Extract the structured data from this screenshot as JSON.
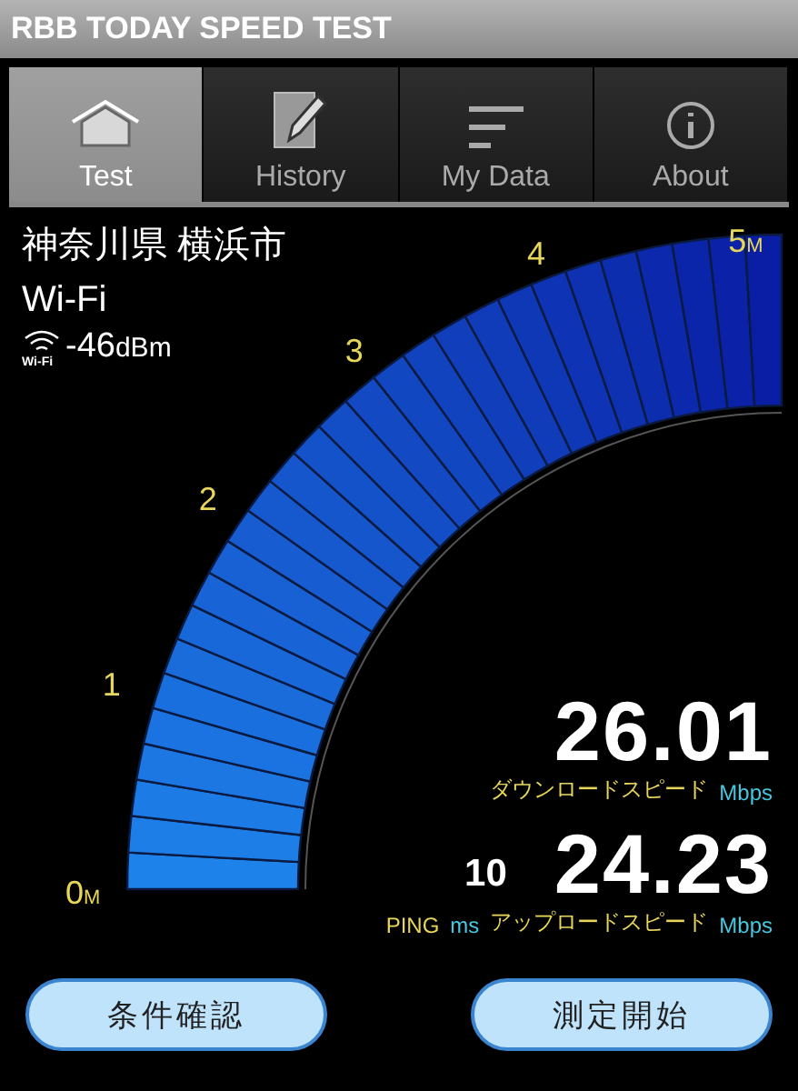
{
  "window": {
    "title": "RBB TODAY SPEED TEST"
  },
  "tabs": [
    {
      "label": "Test",
      "kind": "home",
      "selected": true
    },
    {
      "label": "History",
      "kind": "note",
      "selected": false
    },
    {
      "label": "My Data",
      "kind": "lines",
      "selected": false
    },
    {
      "label": "About",
      "kind": "info",
      "selected": false
    }
  ],
  "location": "神奈川県 横浜市",
  "network": "Wi-Fi",
  "signal": {
    "badge": "Wi-Fi",
    "reading": "-46",
    "unit": "dBm"
  },
  "gauge": {
    "ticks": [
      {
        "label": "0",
        "unit": "M"
      },
      {
        "label": "1"
      },
      {
        "label": "2"
      },
      {
        "label": "3"
      },
      {
        "label": "4"
      },
      {
        "label": "5",
        "unit": "M"
      }
    ]
  },
  "download": {
    "value": "26.01",
    "label": "ダウンロードスピード",
    "unit": "Mbps"
  },
  "ping": {
    "value": "10",
    "label": "PING",
    "unit": "ms"
  },
  "upload": {
    "value": "24.23",
    "label": "アップロードスピード",
    "unit": "Mbps"
  },
  "buttons": [
    "条件確認",
    "測定開始"
  ]
}
